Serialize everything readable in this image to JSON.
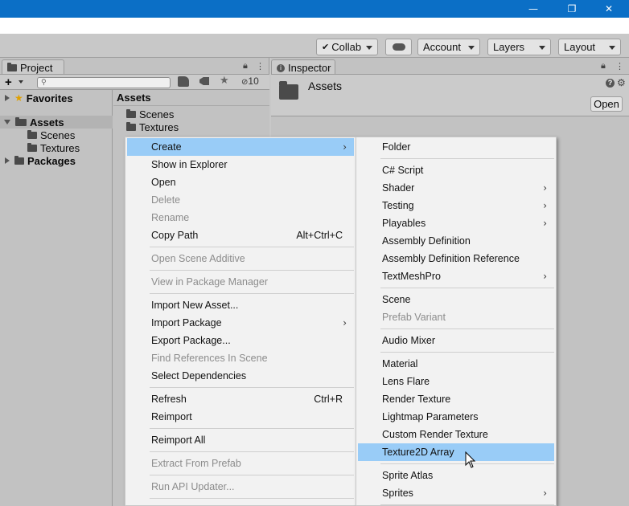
{
  "window": {
    "controls": {
      "minimize": "—",
      "restore": "❐",
      "close": "✕"
    }
  },
  "toolbar": {
    "collab": "Collab",
    "account": "Account",
    "layers": "Layers",
    "layout": "Layout"
  },
  "project": {
    "tab": "Project",
    "hidden_count": "10",
    "tree": {
      "favorites": "Favorites",
      "assets": "Assets",
      "scenes": "Scenes",
      "textures": "Textures",
      "packages": "Packages"
    },
    "list": {
      "header": "Assets",
      "items": [
        "Scenes",
        "Textures"
      ]
    }
  },
  "inspector": {
    "tab": "Inspector",
    "title": "Assets",
    "open_button": "Open"
  },
  "context_menu": {
    "create": "Create",
    "show_in_explorer": "Show in Explorer",
    "open": "Open",
    "delete": "Delete",
    "rename": "Rename",
    "copy_path": "Copy Path",
    "copy_path_shortcut": "Alt+Ctrl+C",
    "open_scene_additive": "Open Scene Additive",
    "view_in_package_manager": "View in Package Manager",
    "import_new_asset": "Import New Asset...",
    "import_package": "Import Package",
    "export_package": "Export Package...",
    "find_references": "Find References In Scene",
    "select_dependencies": "Select Dependencies",
    "refresh": "Refresh",
    "refresh_shortcut": "Ctrl+R",
    "reimport": "Reimport",
    "reimport_all": "Reimport All",
    "extract_from_prefab": "Extract From Prefab",
    "run_api_updater": "Run API Updater..."
  },
  "create_menu": {
    "folder": "Folder",
    "csharp_script": "C# Script",
    "shader": "Shader",
    "testing": "Testing",
    "playables": "Playables",
    "assembly_definition": "Assembly Definition",
    "assembly_definition_reference": "Assembly Definition Reference",
    "textmeshpro": "TextMeshPro",
    "scene": "Scene",
    "prefab_variant": "Prefab Variant",
    "audio_mixer": "Audio Mixer",
    "material": "Material",
    "lens_flare": "Lens Flare",
    "render_texture": "Render Texture",
    "lightmap_parameters": "Lightmap Parameters",
    "custom_render_texture": "Custom Render Texture",
    "texture2d_array": "Texture2D Array",
    "sprite_atlas": "Sprite Atlas",
    "sprites": "Sprites"
  },
  "colors": {
    "titlebar": "#0b6fc6",
    "menu_highlight": "#99ccf7",
    "panel_bg": "#c2c2c2"
  }
}
